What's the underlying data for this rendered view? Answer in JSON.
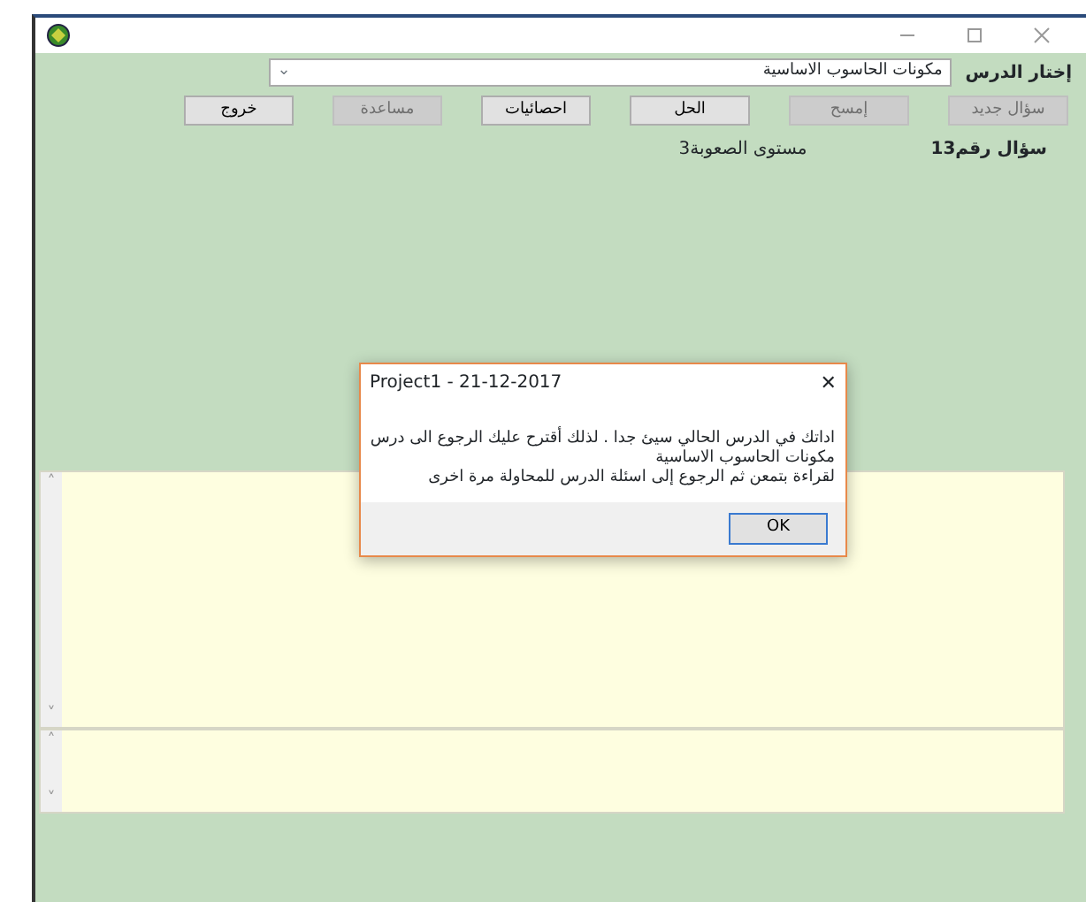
{
  "lesson": {
    "label": "إختار الدرس",
    "value": "مكونات الحاسوب الاساسية",
    "arrow": "⌄"
  },
  "buttons": [
    {
      "label": "سؤال جديد",
      "disabled": true
    },
    {
      "label": "إمسح",
      "disabled": true
    },
    {
      "label": "الحل",
      "disabled": false
    },
    {
      "label": "احصائيات",
      "disabled": false
    },
    {
      "label": "مساعدة",
      "disabled": true
    },
    {
      "label": "خروج",
      "disabled": false
    }
  ],
  "question": {
    "number": "سؤال رقم13",
    "difficulty": "مستوى الصعوبة3"
  },
  "panels": [
    {
      "scroll_up": "˄",
      "scroll_down": "˅"
    },
    {
      "scroll_up": "˄",
      "scroll_down": "˅"
    }
  ],
  "dialog": {
    "title": "Project1 - 21-12-2017",
    "close": "✕",
    "lines": [
      "اداتك في الدرس الحالي سيئ جدا . لذلك أقترح عليك الرجوع  الى درس",
      "مكونات الحاسوب الاساسية",
      "لقراءة بتمعن ثم الرجوع إلى اسئلة الدرس للمحاولة مرة اخرى"
    ],
    "ok": "OK"
  }
}
